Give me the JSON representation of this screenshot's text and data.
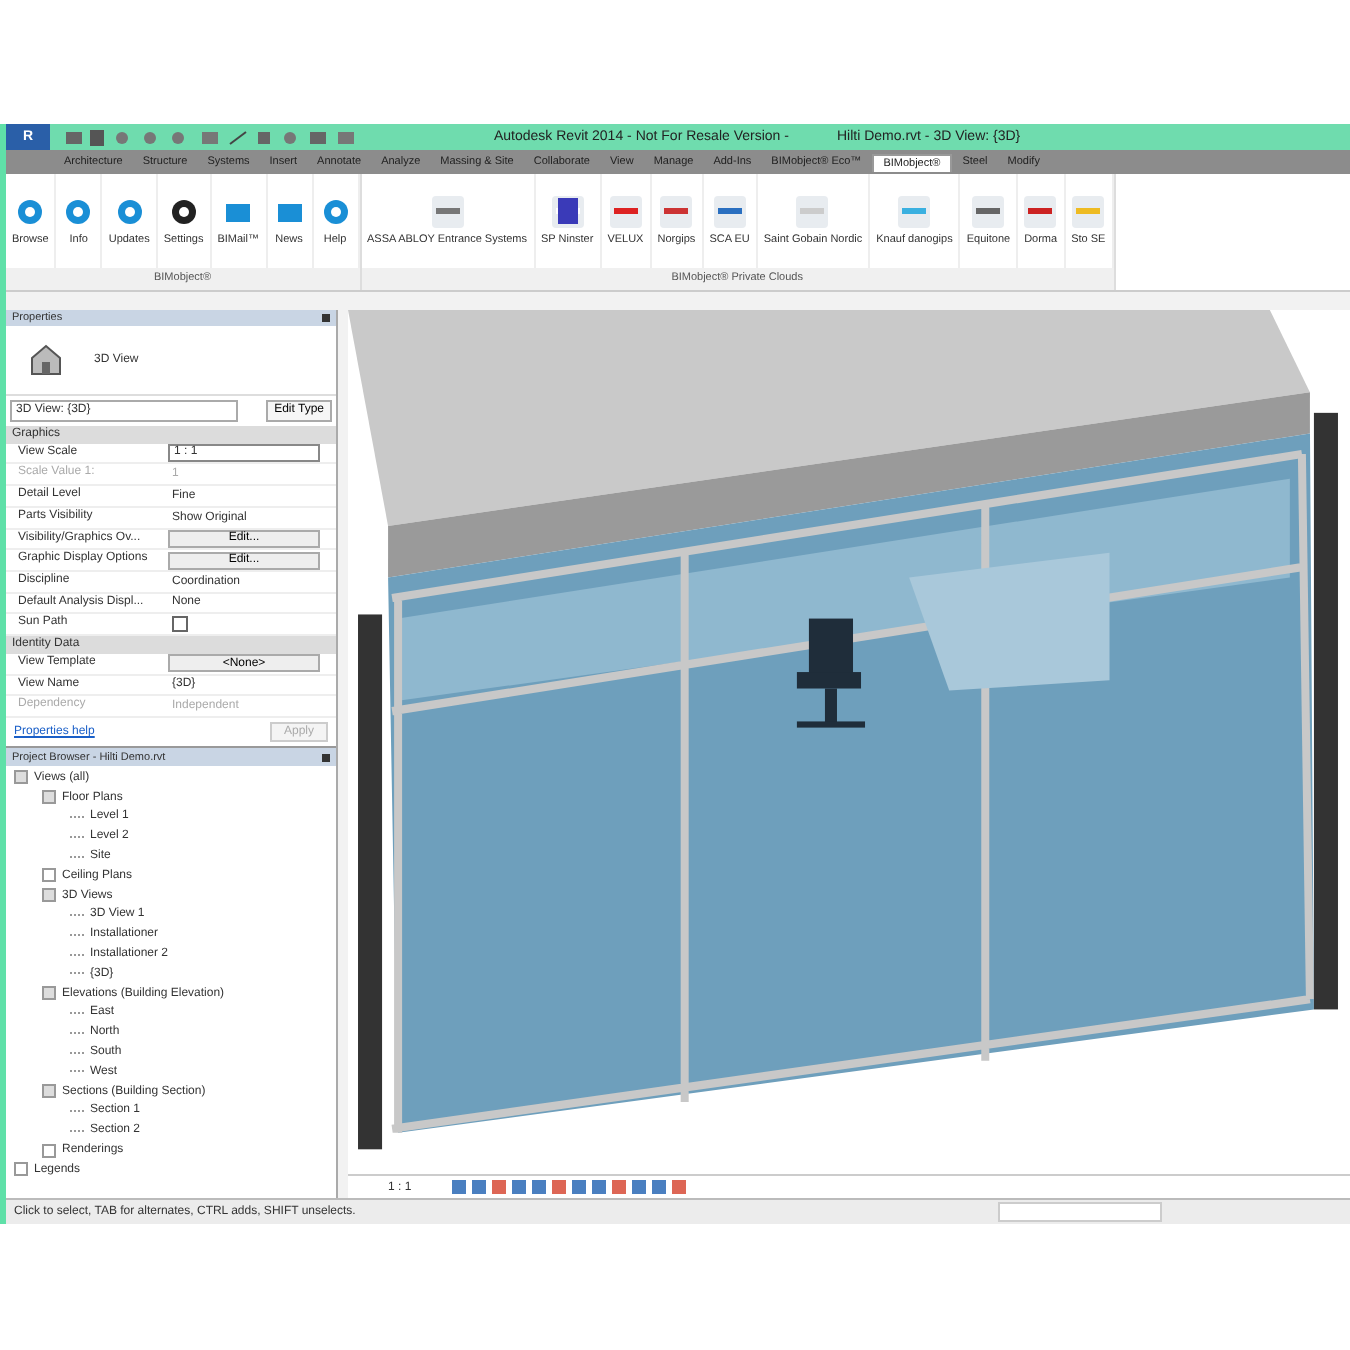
{
  "window": {
    "app_logo": "R",
    "title": "Autodesk Revit 2014 - Not For Resale Version -",
    "document": "Hilti Demo.rvt - 3D View: {3D}"
  },
  "ribbon_tabs": [
    {
      "label": "Architecture",
      "selected": false
    },
    {
      "label": "Structure",
      "selected": false
    },
    {
      "label": "Systems",
      "selected": false
    },
    {
      "label": "Insert",
      "selected": false
    },
    {
      "label": "Annotate",
      "selected": false
    },
    {
      "label": "Analyze",
      "selected": false
    },
    {
      "label": "Massing & Site",
      "selected": false
    },
    {
      "label": "Collaborate",
      "selected": false
    },
    {
      "label": "View",
      "selected": false
    },
    {
      "label": "Manage",
      "selected": false
    },
    {
      "label": "Add-Ins",
      "selected": false
    },
    {
      "label": "BIMobject® Eco™",
      "selected": false
    },
    {
      "label": "BIMobject®",
      "selected": true
    },
    {
      "label": "Steel",
      "selected": false
    },
    {
      "label": "Modify",
      "selected": false
    }
  ],
  "ribbon_panels": [
    {
      "label": "BIMobject®",
      "buttons": [
        "Browse",
        "Info",
        "Updates",
        "Settings",
        "BIMail™",
        "News",
        "Help"
      ]
    },
    {
      "label": "BIMobject® Private Clouds",
      "buttons": [
        "ASSA ABLOY Entrance Systems",
        "SP Ninster",
        "VELUX",
        "Norgips",
        "SCA EU",
        "Saint Gobain Nordic",
        "Knauf danogips",
        "Equitone",
        "Dorma",
        "Sto SE"
      ]
    }
  ],
  "properties": {
    "title": "Properties",
    "type_name": "3D View",
    "type_selector": "3D View: {3D}",
    "edit_type": "Edit Type",
    "groups": [
      {
        "label": "Graphics",
        "rows": [
          {
            "name": "View Scale",
            "value": "1 : 1",
            "kind": "field",
            "disabled": false
          },
          {
            "name": "Scale Value    1:",
            "value": "1",
            "kind": "text",
            "disabled": true
          },
          {
            "name": "Detail Level",
            "value": "Fine",
            "kind": "text",
            "disabled": false
          },
          {
            "name": "Parts Visibility",
            "value": "Show Original",
            "kind": "text",
            "disabled": false
          },
          {
            "name": "Visibility/Graphics Ov...",
            "value": "Edit...",
            "kind": "button",
            "disabled": false
          },
          {
            "name": "Graphic Display Options",
            "value": "Edit...",
            "kind": "button",
            "disabled": false
          },
          {
            "name": "Discipline",
            "value": "Coordination",
            "kind": "text",
            "disabled": false
          },
          {
            "name": "Default Analysis Displ...",
            "value": "None",
            "kind": "text",
            "disabled": false
          },
          {
            "name": "Sun Path",
            "kind": "checkbox",
            "checked": false,
            "disabled": false
          }
        ]
      },
      {
        "label": "Identity Data",
        "rows": [
          {
            "name": "View Template",
            "value": "<None>",
            "kind": "button",
            "disabled": false
          },
          {
            "name": "View Name",
            "value": "{3D}",
            "kind": "text",
            "disabled": false
          },
          {
            "name": "Dependency",
            "value": "Independent",
            "kind": "text",
            "disabled": true
          }
        ]
      }
    ],
    "help_link": "Properties help",
    "apply": "Apply",
    "apply_disabled": true
  },
  "project_browser": {
    "title": "Project Browser - Hilti Demo.rvt",
    "tree": [
      {
        "label": "Views (all)",
        "expanded": true,
        "children": [
          {
            "label": "Floor Plans",
            "expanded": true,
            "children": [
              {
                "label": "Level 1"
              },
              {
                "label": "Level 2"
              },
              {
                "label": "Site"
              }
            ]
          },
          {
            "label": "Ceiling Plans",
            "expanded": false
          },
          {
            "label": "3D Views",
            "expanded": true,
            "children": [
              {
                "label": "3D View 1"
              },
              {
                "label": "Installationer"
              },
              {
                "label": "Installationer 2"
              },
              {
                "label": "{3D}"
              }
            ]
          },
          {
            "label": "Elevations (Building Elevation)",
            "expanded": true,
            "children": [
              {
                "label": "East"
              },
              {
                "label": "North"
              },
              {
                "label": "South"
              },
              {
                "label": "West"
              }
            ]
          },
          {
            "label": "Sections (Building Section)",
            "expanded": true,
            "children": [
              {
                "label": "Section 1"
              },
              {
                "label": "Section 2"
              }
            ]
          },
          {
            "label": "Renderings",
            "expanded": false
          }
        ]
      },
      {
        "label": "Legends",
        "expanded": false
      }
    ]
  },
  "view_scale": "1 : 1",
  "status_bar": {
    "text": "Click to select, TAB for alternates, CTRL adds, SHIFT unselects."
  }
}
